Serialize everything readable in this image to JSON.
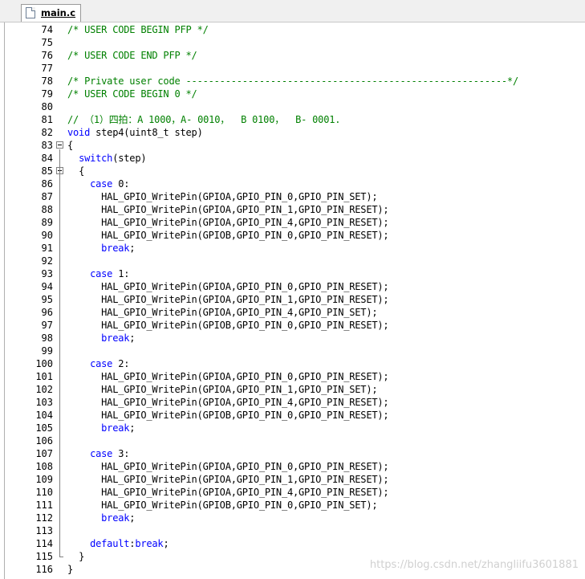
{
  "tab": {
    "label": "main.c"
  },
  "watermark": "https://blog.csdn.net/zhangliifu3601881",
  "colors": {
    "comment": "#008000",
    "keyword": "#0000ff",
    "text": "#000000"
  },
  "lines": [
    {
      "num": "74",
      "indent": "",
      "parts": [
        {
          "t": "/* USER CODE BEGIN PFP */",
          "c": "comment"
        }
      ]
    },
    {
      "num": "75",
      "indent": "",
      "parts": []
    },
    {
      "num": "76",
      "indent": "",
      "parts": [
        {
          "t": "/* USER CODE END PFP */",
          "c": "comment"
        }
      ]
    },
    {
      "num": "77",
      "indent": "",
      "parts": []
    },
    {
      "num": "78",
      "indent": "",
      "parts": [
        {
          "t": "/* Private user code ---------------------------------------------------------*/",
          "c": "comment"
        }
      ]
    },
    {
      "num": "79",
      "indent": "",
      "parts": [
        {
          "t": "/* USER CODE BEGIN 0 */",
          "c": "comment"
        }
      ]
    },
    {
      "num": "80",
      "indent": "",
      "parts": []
    },
    {
      "num": "81",
      "indent": "",
      "parts": [
        {
          "t": "// （1）四拍：A 1000，A- 0010，  B 0100，  B- 0001.",
          "c": "comment"
        }
      ]
    },
    {
      "num": "82",
      "indent": "",
      "parts": [
        {
          "t": "void",
          "c": "kw"
        },
        {
          "t": " step4(uint8_t step)",
          "c": "normal"
        }
      ]
    },
    {
      "num": "83",
      "indent": "",
      "fold": "open",
      "parts": [
        {
          "t": "{",
          "c": "normal"
        }
      ]
    },
    {
      "num": "84",
      "indent": "  ",
      "parts": [
        {
          "t": "switch",
          "c": "kw"
        },
        {
          "t": "(step)",
          "c": "normal"
        }
      ]
    },
    {
      "num": "85",
      "indent": "  ",
      "fold": "open",
      "parts": [
        {
          "t": "{",
          "c": "normal"
        }
      ]
    },
    {
      "num": "86",
      "indent": "    ",
      "parts": [
        {
          "t": "case",
          "c": "kw"
        },
        {
          "t": " 0:",
          "c": "normal"
        }
      ]
    },
    {
      "num": "87",
      "indent": "      ",
      "parts": [
        {
          "t": "HAL_GPIO_WritePin(GPIOA,GPIO_PIN_0,GPIO_PIN_SET);",
          "c": "normal"
        }
      ]
    },
    {
      "num": "88",
      "indent": "      ",
      "parts": [
        {
          "t": "HAL_GPIO_WritePin(GPIOA,GPIO_PIN_1,GPIO_PIN_RESET);",
          "c": "normal"
        }
      ]
    },
    {
      "num": "89",
      "indent": "      ",
      "parts": [
        {
          "t": "HAL_GPIO_WritePin(GPIOA,GPIO_PIN_4,GPIO_PIN_RESET);",
          "c": "normal"
        }
      ]
    },
    {
      "num": "90",
      "indent": "      ",
      "parts": [
        {
          "t": "HAL_GPIO_WritePin(GPIOB,GPIO_PIN_0,GPIO_PIN_RESET);",
          "c": "normal"
        }
      ]
    },
    {
      "num": "91",
      "indent": "      ",
      "parts": [
        {
          "t": "break",
          "c": "kw"
        },
        {
          "t": ";",
          "c": "normal"
        }
      ]
    },
    {
      "num": "92",
      "indent": "",
      "parts": []
    },
    {
      "num": "93",
      "indent": "    ",
      "parts": [
        {
          "t": "case",
          "c": "kw"
        },
        {
          "t": " 1:",
          "c": "normal"
        }
      ]
    },
    {
      "num": "94",
      "indent": "      ",
      "parts": [
        {
          "t": "HAL_GPIO_WritePin(GPIOA,GPIO_PIN_0,GPIO_PIN_RESET);",
          "c": "normal"
        }
      ]
    },
    {
      "num": "95",
      "indent": "      ",
      "parts": [
        {
          "t": "HAL_GPIO_WritePin(GPIOA,GPIO_PIN_1,GPIO_PIN_RESET);",
          "c": "normal"
        }
      ]
    },
    {
      "num": "96",
      "indent": "      ",
      "parts": [
        {
          "t": "HAL_GPIO_WritePin(GPIOA,GPIO_PIN_4,GPIO_PIN_SET);",
          "c": "normal"
        }
      ]
    },
    {
      "num": "97",
      "indent": "      ",
      "parts": [
        {
          "t": "HAL_GPIO_WritePin(GPIOB,GPIO_PIN_0,GPIO_PIN_RESET);",
          "c": "normal"
        }
      ]
    },
    {
      "num": "98",
      "indent": "      ",
      "parts": [
        {
          "t": "break",
          "c": "kw"
        },
        {
          "t": ";",
          "c": "normal"
        }
      ]
    },
    {
      "num": "99",
      "indent": "",
      "parts": []
    },
    {
      "num": "100",
      "indent": "    ",
      "parts": [
        {
          "t": "case",
          "c": "kw"
        },
        {
          "t": " 2:",
          "c": "normal"
        }
      ]
    },
    {
      "num": "101",
      "indent": "      ",
      "parts": [
        {
          "t": "HAL_GPIO_WritePin(GPIOA,GPIO_PIN_0,GPIO_PIN_RESET);",
          "c": "normal"
        }
      ]
    },
    {
      "num": "102",
      "indent": "      ",
      "parts": [
        {
          "t": "HAL_GPIO_WritePin(GPIOA,GPIO_PIN_1,GPIO_PIN_SET);",
          "c": "normal"
        }
      ]
    },
    {
      "num": "103",
      "indent": "      ",
      "parts": [
        {
          "t": "HAL_GPIO_WritePin(GPIOA,GPIO_PIN_4,GPIO_PIN_RESET);",
          "c": "normal"
        }
      ]
    },
    {
      "num": "104",
      "indent": "      ",
      "parts": [
        {
          "t": "HAL_GPIO_WritePin(GPIOB,GPIO_PIN_0,GPIO_PIN_RESET);",
          "c": "normal"
        }
      ]
    },
    {
      "num": "105",
      "indent": "      ",
      "parts": [
        {
          "t": "break",
          "c": "kw"
        },
        {
          "t": ";",
          "c": "normal"
        }
      ]
    },
    {
      "num": "106",
      "indent": "",
      "parts": []
    },
    {
      "num": "107",
      "indent": "    ",
      "parts": [
        {
          "t": "case",
          "c": "kw"
        },
        {
          "t": " 3:",
          "c": "normal"
        }
      ]
    },
    {
      "num": "108",
      "indent": "      ",
      "parts": [
        {
          "t": "HAL_GPIO_WritePin(GPIOA,GPIO_PIN_0,GPIO_PIN_RESET);",
          "c": "normal"
        }
      ]
    },
    {
      "num": "109",
      "indent": "      ",
      "parts": [
        {
          "t": "HAL_GPIO_WritePin(GPIOA,GPIO_PIN_1,GPIO_PIN_RESET);",
          "c": "normal"
        }
      ]
    },
    {
      "num": "110",
      "indent": "      ",
      "parts": [
        {
          "t": "HAL_GPIO_WritePin(GPIOA,GPIO_PIN_4,GPIO_PIN_RESET);",
          "c": "normal"
        }
      ]
    },
    {
      "num": "111",
      "indent": "      ",
      "parts": [
        {
          "t": "HAL_GPIO_WritePin(GPIOB,GPIO_PIN_0,GPIO_PIN_SET);",
          "c": "normal"
        }
      ]
    },
    {
      "num": "112",
      "indent": "      ",
      "parts": [
        {
          "t": "break",
          "c": "kw"
        },
        {
          "t": ";",
          "c": "normal"
        }
      ]
    },
    {
      "num": "113",
      "indent": "",
      "parts": []
    },
    {
      "num": "114",
      "indent": "    ",
      "parts": [
        {
          "t": "default",
          "c": "kw"
        },
        {
          "t": ":",
          "c": "normal"
        },
        {
          "t": "break",
          "c": "kw"
        },
        {
          "t": ";",
          "c": "normal"
        }
      ]
    },
    {
      "num": "115",
      "indent": "  ",
      "fold": "end",
      "parts": [
        {
          "t": "}",
          "c": "normal"
        }
      ]
    },
    {
      "num": "116",
      "indent": "",
      "parts": [
        {
          "t": "}",
          "c": "normal"
        }
      ]
    }
  ]
}
